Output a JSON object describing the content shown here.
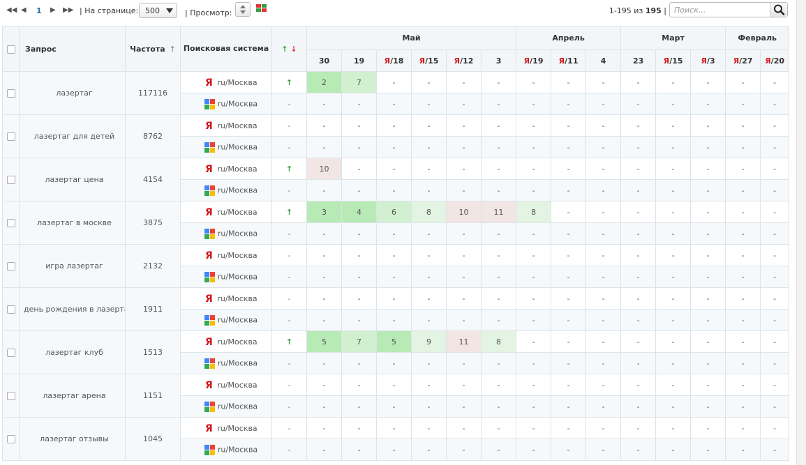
{
  "toolbar": {
    "current_page": "1",
    "per_page_label": "| На странице:",
    "per_page_value": "500",
    "view_label": "| Просмотр:",
    "count_range": "1-195 из",
    "count_total": "195",
    "count_sep": "|",
    "search_placeholder": "Поиск..."
  },
  "colors": {
    "accent": "#2a6fa8",
    "yandex_red": "#d5171c",
    "pos_green": "#b7eab5",
    "pos_green_light": "#d1f0cf",
    "pos_pink": "#f1e6e4"
  },
  "table": {
    "headers": {
      "query": "Запрос",
      "frequency": "Частота",
      "frequency_sort": "↑",
      "engine": "Поисковая система",
      "dynamics_up": "↑",
      "dynamics_down": "↓"
    },
    "months": [
      {
        "name": "Май",
        "span": 6
      },
      {
        "name": "Апрель",
        "span": 3
      },
      {
        "name": "Март",
        "span": 3
      },
      {
        "name": "Февраль",
        "span": 2
      }
    ],
    "dates": [
      {
        "label": "30",
        "yandex": false
      },
      {
        "label": "19",
        "yandex": false
      },
      {
        "label": "/18",
        "yandex": true
      },
      {
        "label": "/15",
        "yandex": true
      },
      {
        "label": "/12",
        "yandex": true
      },
      {
        "label": "3",
        "yandex": false
      },
      {
        "label": "/19",
        "yandex": true
      },
      {
        "label": "/11",
        "yandex": true
      },
      {
        "label": "4",
        "yandex": false
      },
      {
        "label": "23",
        "yandex": false
      },
      {
        "label": "/15",
        "yandex": true
      },
      {
        "label": "/3",
        "yandex": true
      },
      {
        "label": "/27",
        "yandex": true
      },
      {
        "label": "/20",
        "yandex": true
      }
    ],
    "yandex_mark": "Я",
    "region": "ru/Москва",
    "rows": [
      {
        "query": "лазертаг",
        "frequency": "117116",
        "yandex": {
          "trend": "↑",
          "positions": [
            "2",
            "7",
            "-",
            "-",
            "-",
            "-",
            "-",
            "-",
            "-",
            "-",
            "-",
            "-",
            "-",
            "-"
          ],
          "tones": [
            "g1",
            "g2",
            "",
            "",
            "",
            "",
            "",
            "",
            "",
            "",
            "",
            "",
            "",
            ""
          ]
        },
        "google": {
          "trend": "-",
          "positions": [
            "-",
            "-",
            "-",
            "-",
            "-",
            "-",
            "-",
            "-",
            "-",
            "-",
            "-",
            "-",
            "-",
            "-"
          ],
          "tones": []
        }
      },
      {
        "query": "лазертаг для детей",
        "frequency": "8762",
        "yandex": {
          "trend": "-",
          "positions": [
            "-",
            "-",
            "-",
            "-",
            "-",
            "-",
            "-",
            "-",
            "-",
            "-",
            "-",
            "-",
            "-",
            "-"
          ],
          "tones": []
        },
        "google": {
          "trend": "-",
          "positions": [
            "-",
            "-",
            "-",
            "-",
            "-",
            "-",
            "-",
            "-",
            "-",
            "-",
            "-",
            "-",
            "-",
            "-"
          ],
          "tones": []
        }
      },
      {
        "query": "лазертаг цена",
        "frequency": "4154",
        "yandex": {
          "trend": "↑",
          "positions": [
            "10",
            "-",
            "-",
            "-",
            "-",
            "-",
            "-",
            "-",
            "-",
            "-",
            "-",
            "-",
            "-",
            "-"
          ],
          "tones": [
            "p"
          ]
        },
        "google": {
          "trend": "-",
          "positions": [
            "-",
            "-",
            "-",
            "-",
            "-",
            "-",
            "-",
            "-",
            "-",
            "-",
            "-",
            "-",
            "-",
            "-"
          ],
          "tones": []
        }
      },
      {
        "query": "лазертаг в москве",
        "frequency": "3875",
        "yandex": {
          "trend": "↑",
          "positions": [
            "3",
            "4",
            "6",
            "8",
            "10",
            "11",
            "8",
            "-",
            "-",
            "-",
            "-",
            "-",
            "-",
            "-"
          ],
          "tones": [
            "g1",
            "g1",
            "g2",
            "g3",
            "p",
            "p",
            "g3"
          ]
        },
        "google": {
          "trend": "-",
          "positions": [
            "-",
            "-",
            "-",
            "-",
            "-",
            "-",
            "-",
            "-",
            "-",
            "-",
            "-",
            "-",
            "-",
            "-"
          ],
          "tones": []
        }
      },
      {
        "query": "игра лазертаг",
        "frequency": "2132",
        "yandex": {
          "trend": "-",
          "positions": [
            "-",
            "-",
            "-",
            "-",
            "-",
            "-",
            "-",
            "-",
            "-",
            "-",
            "-",
            "-",
            "-",
            "-"
          ],
          "tones": []
        },
        "google": {
          "trend": "-",
          "positions": [
            "-",
            "-",
            "-",
            "-",
            "-",
            "-",
            "-",
            "-",
            "-",
            "-",
            "-",
            "-",
            "-",
            "-"
          ],
          "tones": []
        }
      },
      {
        "query": "день рождения в лазертаге",
        "frequency": "1911",
        "yandex": {
          "trend": "-",
          "positions": [
            "-",
            "-",
            "-",
            "-",
            "-",
            "-",
            "-",
            "-",
            "-",
            "-",
            "-",
            "-",
            "-",
            "-"
          ],
          "tones": []
        },
        "google": {
          "trend": "-",
          "positions": [
            "-",
            "-",
            "-",
            "-",
            "-",
            "-",
            "-",
            "-",
            "-",
            "-",
            "-",
            "-",
            "-",
            "-"
          ],
          "tones": []
        }
      },
      {
        "query": "лазертаг клуб",
        "frequency": "1513",
        "yandex": {
          "trend": "↑",
          "positions": [
            "5",
            "7",
            "5",
            "9",
            "11",
            "8",
            "-",
            "-",
            "-",
            "-",
            "-",
            "-",
            "-",
            "-"
          ],
          "tones": [
            "g1",
            "g2",
            "g1",
            "g3",
            "p",
            "g3"
          ]
        },
        "google": {
          "trend": "-",
          "positions": [
            "-",
            "-",
            "-",
            "-",
            "-",
            "-",
            "-",
            "-",
            "-",
            "-",
            "-",
            "-",
            "-",
            "-"
          ],
          "tones": []
        }
      },
      {
        "query": "лазертаг арена",
        "frequency": "1151",
        "yandex": {
          "trend": "-",
          "positions": [
            "-",
            "-",
            "-",
            "-",
            "-",
            "-",
            "-",
            "-",
            "-",
            "-",
            "-",
            "-",
            "-",
            "-"
          ],
          "tones": []
        },
        "google": {
          "trend": "-",
          "positions": [
            "-",
            "-",
            "-",
            "-",
            "-",
            "-",
            "-",
            "-",
            "-",
            "-",
            "-",
            "-",
            "-",
            "-"
          ],
          "tones": []
        }
      },
      {
        "query": "лазертаг отзывы",
        "frequency": "1045",
        "yandex": {
          "trend": "-",
          "positions": [
            "-",
            "-",
            "-",
            "-",
            "-",
            "-",
            "-",
            "-",
            "-",
            "-",
            "-",
            "-",
            "-",
            "-"
          ],
          "tones": []
        },
        "google": {
          "trend": "-",
          "positions": [
            "-",
            "-",
            "-",
            "-",
            "-",
            "-",
            "-",
            "-",
            "-",
            "-",
            "-",
            "-",
            "-",
            "-"
          ],
          "tones": []
        }
      }
    ]
  }
}
